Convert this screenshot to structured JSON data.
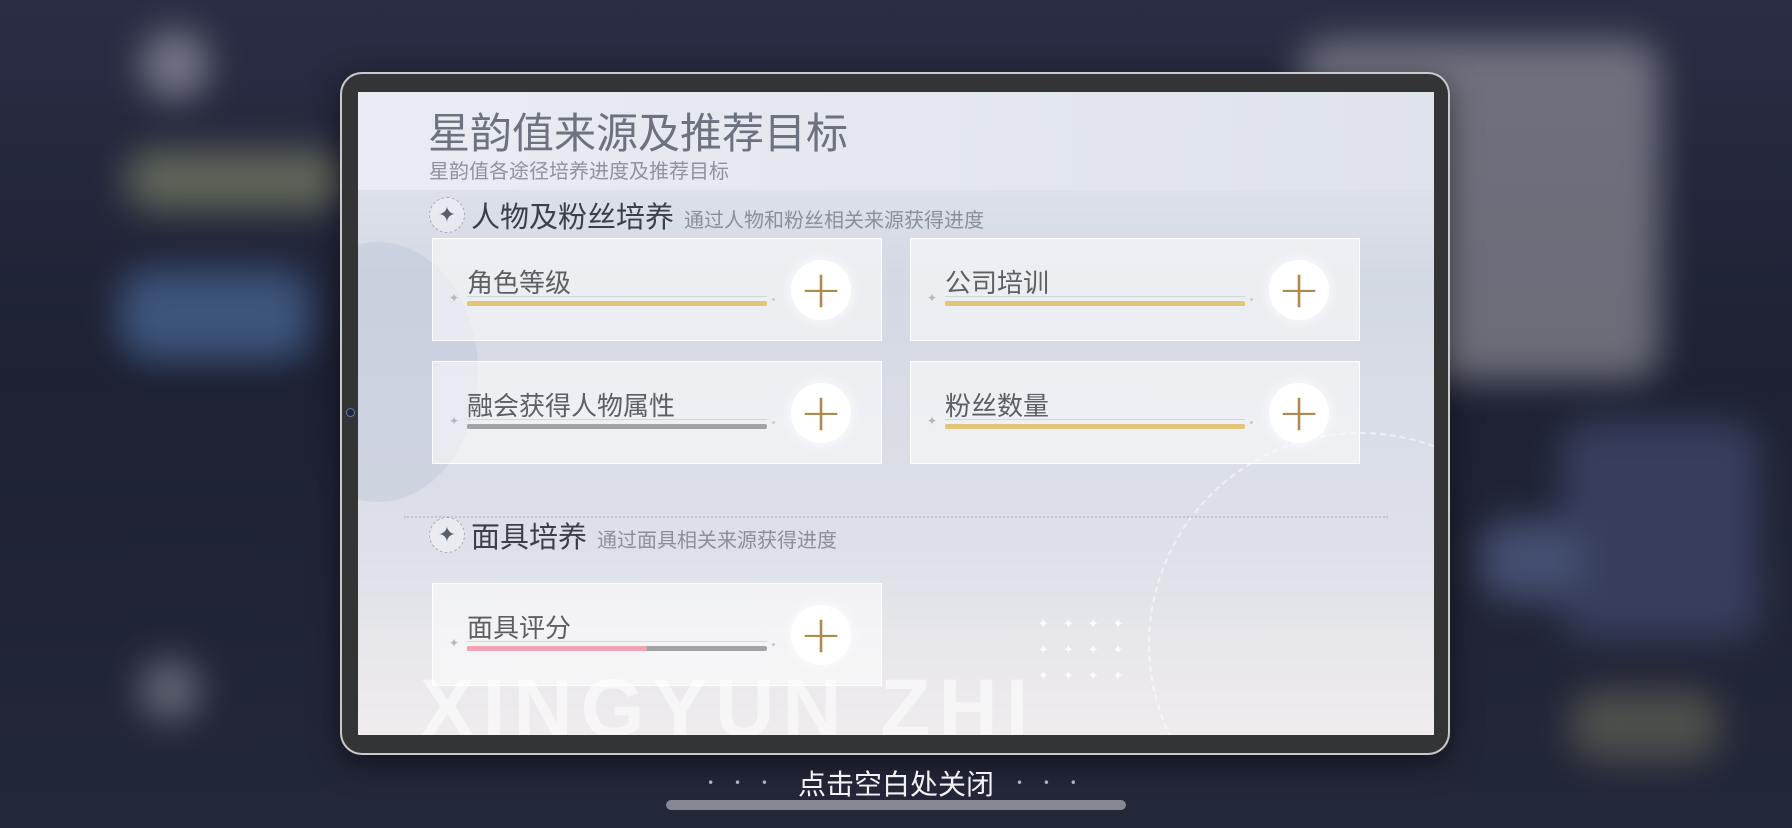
{
  "panel": {
    "title": "星韵值来源及推荐目标",
    "subtitle": "星韵值各途径培养进度及推荐目标",
    "watermark": "XINGYUN ZHI"
  },
  "sections": [
    {
      "icon": "sparkle-icon",
      "title": "人物及粉丝培养",
      "description": "通过人物和粉丝相关来源获得进度",
      "cards": [
        {
          "label": "角色等级",
          "progress": 1.0,
          "bar_color": "#e3c57a"
        },
        {
          "label": "公司培训",
          "progress": 1.0,
          "bar_color": "#e3c57a"
        },
        {
          "label": "融会获得人物属性",
          "progress": 1.0,
          "bar_color": "#a2a3a6"
        },
        {
          "label": "粉丝数量",
          "progress": 1.0,
          "bar_color": "#e3c57a"
        }
      ]
    },
    {
      "icon": "sparkle-icon",
      "title": "面具培养",
      "description": "通过面具相关来源获得进度",
      "cards": [
        {
          "label": "面具评分",
          "progress": 0.6,
          "bar_color": "#f0a3b3",
          "track_color": "#a2a3a6"
        }
      ]
    }
  ],
  "footer": {
    "close_hint": "点击空白处关闭"
  },
  "icons": {
    "add": "plus-icon",
    "section": "sparkle-icon"
  },
  "colors": {
    "accent_gold": "#b0894e",
    "progress_gold": "#e3c57a",
    "progress_pink": "#f0a3b3"
  }
}
